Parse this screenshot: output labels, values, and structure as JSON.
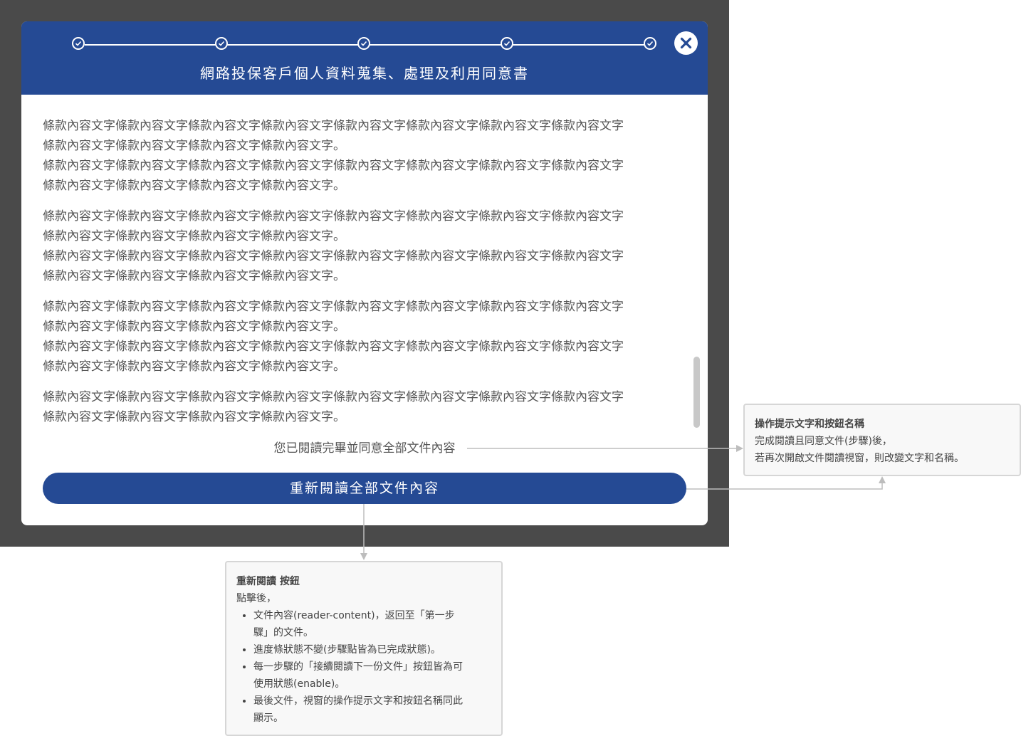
{
  "modal": {
    "title": "網路投保客戶個人資料蒐集、處理及利用同意書",
    "steps": [
      "done",
      "done",
      "done",
      "done",
      "done"
    ],
    "paragraphs": [
      [
        "條款內容文字條款內容文字條款內容文字條款內容文字條款內容文字條款內容文字條款內容文字條款內容文字",
        "條款內容文字條款內容文字條款內容文字條款內容文字。",
        "條款內容文字條款內容文字條款內容文字條款內容文字條款內容文字條款內容文字條款內容文字條款內容文字",
        "條款內容文字條款內容文字條款內容文字條款內容文字。"
      ],
      [
        "條款內容文字條款內容文字條款內容文字條款內容文字條款內容文字條款內容文字條款內容文字條款內容文字",
        "條款內容文字條款內容文字條款內容文字條款內容文字。",
        "條款內容文字條款內容文字條款內容文字條款內容文字條款內容文字條款內容文字條款內容文字條款內容文字",
        "條款內容文字條款內容文字條款內容文字條款內容文字。"
      ],
      [
        "條款內容文字條款內容文字條款內容文字條款內容文字條款內容文字條款內容文字條款內容文字條款內容文字",
        "條款內容文字條款內容文字條款內容文字條款內容文字。",
        "條款內容文字條款內容文字條款內容文字條款內容文字條款內容文字條款內容文字條款內容文字條款內容文字",
        "條款內容文字條款內容文字條款內容文字條款內容文字。"
      ],
      [
        "條款內容文字條款內容文字條款內容文字條款內容文字條款內容文字條款內容文字條款內容文字條款內容文字",
        "條款內容文字條款內容文字條款內容文字條款內容文字。"
      ]
    ],
    "agree_text": "您已閱讀完畢並同意全部文件內容",
    "reread_button": "重新閱讀全部文件內容"
  },
  "notes": {
    "right": {
      "title": "操作提示文字和按鈕名稱",
      "lines": [
        "完成閱讀且同意文件(步驟)後，",
        "若再次開啟文件閱讀視窗，則改變文字和名稱。"
      ]
    },
    "bottom": {
      "title": "重新閱讀 按鈕",
      "intro": "點擊後，",
      "bullets": [
        [
          "文件內容(reader-content)，返回至「第一步",
          "驟」的文件。"
        ],
        [
          "進度條狀態不變(步驟點皆為已完成狀態)。"
        ],
        [
          "每一步驟的「接續閱讀下一份文件」按鈕皆為可",
          "使用狀態(enable)。"
        ],
        [
          "最後文件，視窗的操作提示文字和按鈕名稱同此",
          "顯示。"
        ]
      ]
    }
  },
  "colors": {
    "brand": "#254a94",
    "overlay": "#4a4a4a"
  }
}
